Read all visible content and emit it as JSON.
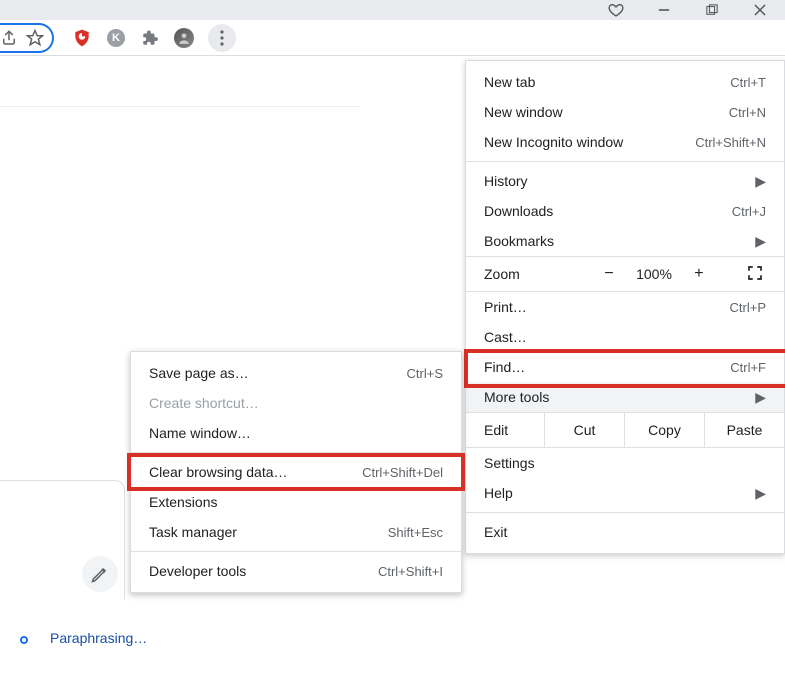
{
  "titlebar": {},
  "toolbar": {},
  "status": {
    "text": "Paraphrasing…"
  },
  "main_menu": {
    "new_tab": {
      "label": "New tab",
      "shortcut": "Ctrl+T"
    },
    "new_window": {
      "label": "New window",
      "shortcut": "Ctrl+N"
    },
    "new_incognito": {
      "label": "New Incognito window",
      "shortcut": "Ctrl+Shift+N"
    },
    "history": {
      "label": "History"
    },
    "downloads": {
      "label": "Downloads",
      "shortcut": "Ctrl+J"
    },
    "bookmarks": {
      "label": "Bookmarks"
    },
    "zoom": {
      "label": "Zoom",
      "level": "100%",
      "minus": "−",
      "plus": "+"
    },
    "print": {
      "label": "Print…",
      "shortcut": "Ctrl+P"
    },
    "cast": {
      "label": "Cast…"
    },
    "find": {
      "label": "Find…",
      "shortcut": "Ctrl+F"
    },
    "more_tools": {
      "label": "More tools"
    },
    "edit": {
      "label": "Edit",
      "cut": "Cut",
      "copy": "Copy",
      "paste": "Paste"
    },
    "settings": {
      "label": "Settings"
    },
    "help": {
      "label": "Help"
    },
    "exit": {
      "label": "Exit"
    }
  },
  "sub_menu": {
    "save_as": {
      "label": "Save page as…",
      "shortcut": "Ctrl+S"
    },
    "create_shortcut": {
      "label": "Create shortcut…"
    },
    "name_window": {
      "label": "Name window…"
    },
    "clear_data": {
      "label": "Clear browsing data…",
      "shortcut": "Ctrl+Shift+Del"
    },
    "extensions": {
      "label": "Extensions"
    },
    "task_manager": {
      "label": "Task manager",
      "shortcut": "Shift+Esc"
    },
    "dev_tools": {
      "label": "Developer tools",
      "shortcut": "Ctrl+Shift+I"
    }
  }
}
